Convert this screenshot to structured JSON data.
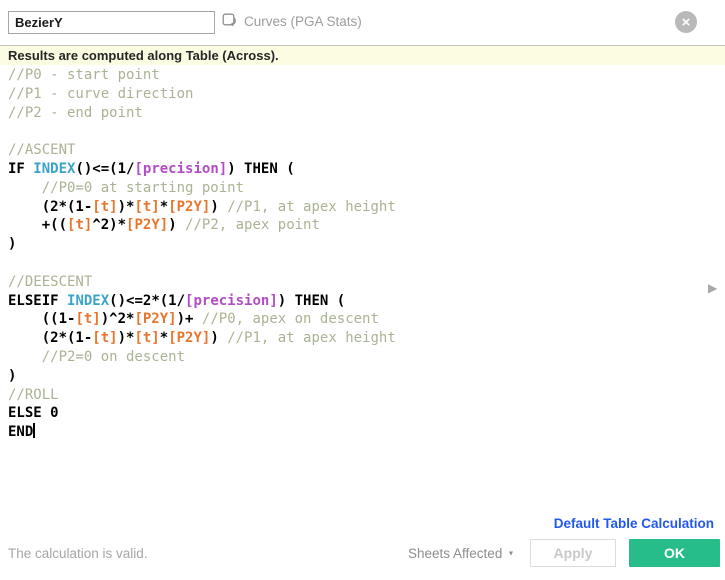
{
  "header": {
    "name_value": "BezierY",
    "context_label": "Curves (PGA Stats)",
    "close_glyph": "×"
  },
  "banner": {
    "text": "Results are computed along Table (Across)."
  },
  "code": {
    "colors": {
      "cm": "#aab394",
      "kw": "#000000",
      "pl": "#000000",
      "fn": "#3aa3c9",
      "fld": "#e8762d",
      "prm": "#b44bc8"
    },
    "caret_after_line": 20,
    "lines": [
      [
        [
          "cm",
          "//P0 - start point"
        ]
      ],
      [
        [
          "cm",
          "//P1 - curve direction"
        ]
      ],
      [
        [
          "cm",
          "//P2 - end point"
        ]
      ],
      [],
      [
        [
          "cm",
          "//ASCENT"
        ]
      ],
      [
        [
          "kw",
          "IF "
        ],
        [
          "fn",
          "INDEX"
        ],
        [
          "pl",
          "()<=(1/"
        ],
        [
          "prm",
          "[precision]"
        ],
        [
          "pl",
          ") "
        ],
        [
          "kw",
          "THEN"
        ],
        [
          "pl",
          " ("
        ]
      ],
      [
        [
          "cm",
          "    //P0=0 at starting point"
        ]
      ],
      [
        [
          "pl",
          "    (2*(1-"
        ],
        [
          "fld",
          "[t]"
        ],
        [
          "pl",
          ")*"
        ],
        [
          "fld",
          "[t]"
        ],
        [
          "pl",
          "*"
        ],
        [
          "fld",
          "[P2Y]"
        ],
        [
          "pl",
          ") "
        ],
        [
          "cm",
          "//P1, at apex height"
        ]
      ],
      [
        [
          "pl",
          "    +(("
        ],
        [
          "fld",
          "[t]"
        ],
        [
          "pl",
          "^2)*"
        ],
        [
          "fld",
          "[P2Y]"
        ],
        [
          "pl",
          ") "
        ],
        [
          "cm",
          "//P2, apex point"
        ]
      ],
      [
        [
          "pl",
          ")"
        ]
      ],
      [],
      [
        [
          "cm",
          "//DEESCENT"
        ]
      ],
      [
        [
          "kw",
          "ELSEIF "
        ],
        [
          "fn",
          "INDEX"
        ],
        [
          "pl",
          "()<=2*(1/"
        ],
        [
          "prm",
          "[precision]"
        ],
        [
          "pl",
          ") "
        ],
        [
          "kw",
          "THEN"
        ],
        [
          "pl",
          " ("
        ]
      ],
      [
        [
          "pl",
          "    ((1-"
        ],
        [
          "fld",
          "[t]"
        ],
        [
          "pl",
          ")^2*"
        ],
        [
          "fld",
          "[P2Y]"
        ],
        [
          "pl",
          ")+ "
        ],
        [
          "cm",
          "//P0, apex on descent"
        ]
      ],
      [
        [
          "pl",
          "    (2*(1-"
        ],
        [
          "fld",
          "[t]"
        ],
        [
          "pl",
          ")*"
        ],
        [
          "fld",
          "[t]"
        ],
        [
          "pl",
          "*"
        ],
        [
          "fld",
          "[P2Y]"
        ],
        [
          "pl",
          ") "
        ],
        [
          "cm",
          "//P1, at apex height"
        ]
      ],
      [
        [
          "cm",
          "    //P2=0 on descent"
        ]
      ],
      [
        [
          "pl",
          ")"
        ]
      ],
      [
        [
          "cm",
          "//ROLL"
        ]
      ],
      [
        [
          "kw",
          "ELSE "
        ],
        [
          "pl",
          "0"
        ]
      ],
      [
        [
          "kw",
          "END"
        ]
      ]
    ]
  },
  "icons": {
    "expand_arrow": "▶",
    "dropdown_arrow": "▼"
  },
  "footer": {
    "link": "Default Table Calculation",
    "status": "The calculation is valid.",
    "sheets_affected": "Sheets Affected",
    "apply": "Apply",
    "ok": "OK"
  },
  "colors": {
    "ok_green": "#27bd8a",
    "link_blue": "#2257ef",
    "banner_bg": "#fcfce3"
  }
}
